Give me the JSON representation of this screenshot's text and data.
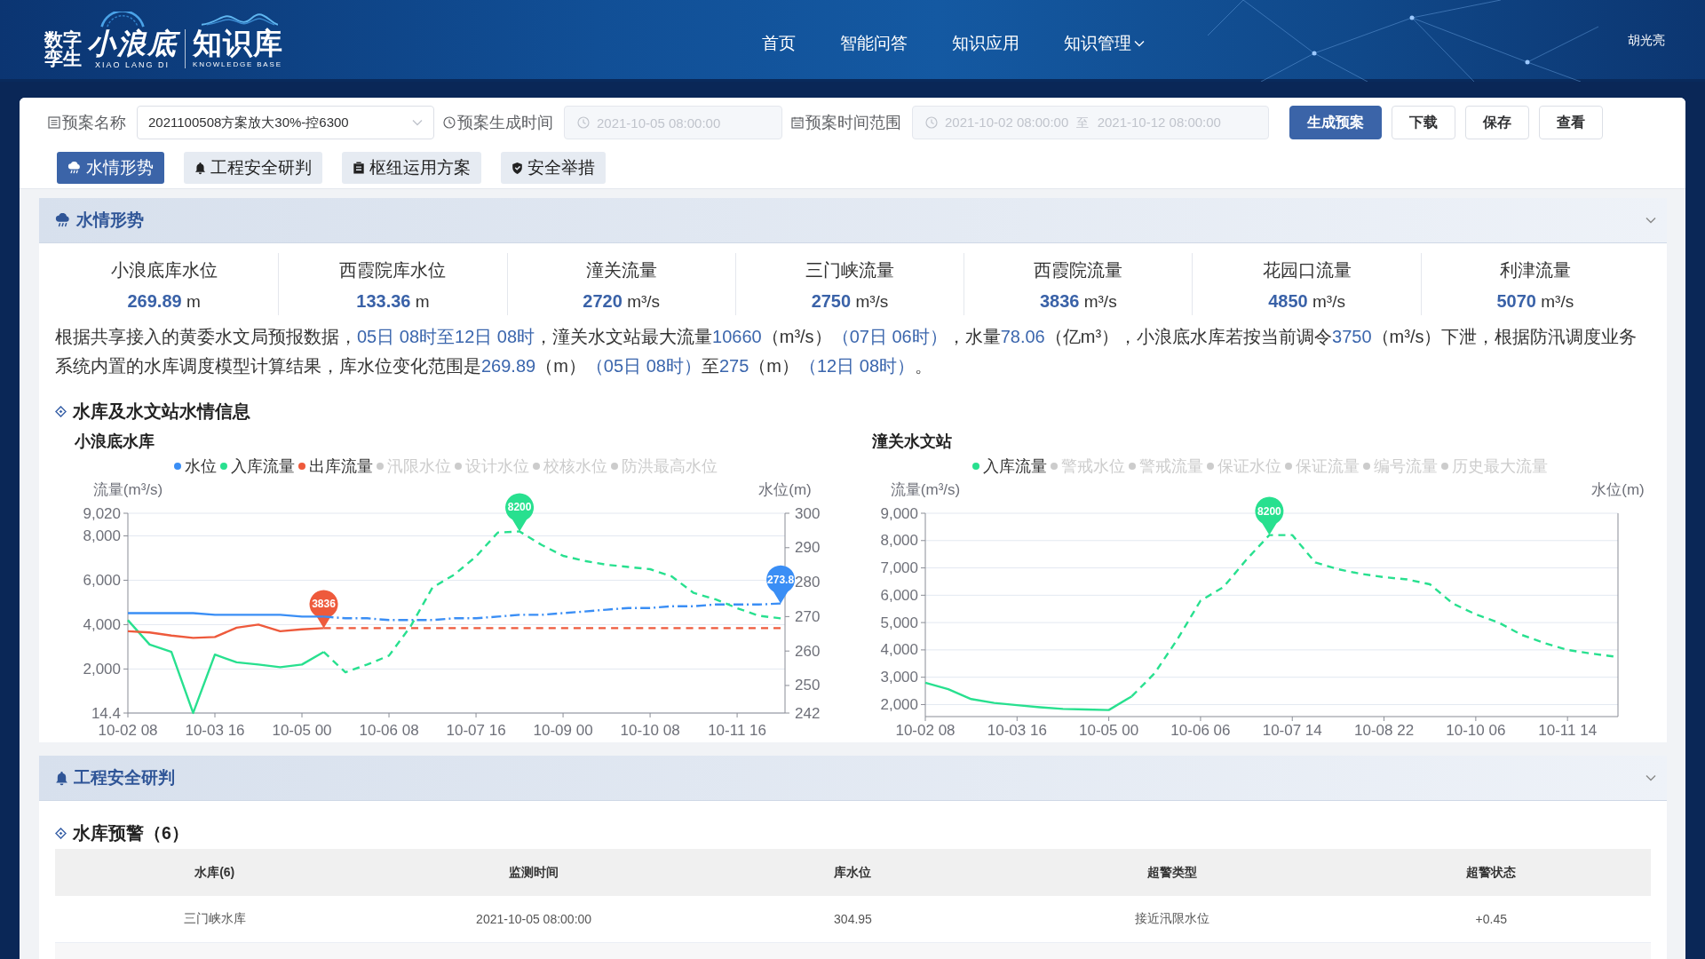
{
  "header": {
    "logo": {
      "prefix": "数字孪生",
      "name": "小浪底",
      "name_latin": "XIAO LANG DI",
      "title": "知识库",
      "title_latin": "KNOWLEDGE BASE"
    },
    "nav": [
      {
        "label": "首页",
        "dropdown": false
      },
      {
        "label": "智能问答",
        "dropdown": false
      },
      {
        "label": "知识应用",
        "dropdown": false
      },
      {
        "label": "知识管理",
        "dropdown": true
      }
    ],
    "user": "胡光亮"
  },
  "toolbar": {
    "fields": [
      {
        "kind": "select",
        "label": "预案名称",
        "value": "2021100508方案放大30%-控6300",
        "disabled": false
      },
      {
        "kind": "datetime",
        "label": "预案生成时间",
        "value": "2021-10-05 08:00:00",
        "disabled": true
      },
      {
        "kind": "range",
        "label": "预案时间范围",
        "start": "2021-10-02 08:00:00",
        "separator": "至",
        "end": "2021-10-12 08:00:00",
        "disabled": true
      }
    ],
    "buttons": [
      {
        "label": "生成预案",
        "primary": true
      },
      {
        "label": "下载",
        "primary": false
      },
      {
        "label": "保存",
        "primary": false
      },
      {
        "label": "查看",
        "primary": false
      }
    ]
  },
  "tabs": [
    {
      "label": "水情形势",
      "selected": true
    },
    {
      "label": "工程安全研判",
      "selected": false
    },
    {
      "label": "枢纽运用方案",
      "selected": false
    },
    {
      "label": "安全举措",
      "selected": false
    }
  ],
  "sections": [
    {
      "kind": "situation",
      "title": "水情形势",
      "expanded": true,
      "stats": [
        {
          "label": "小浪底库水位",
          "value": "269.89",
          "unit": "m"
        },
        {
          "label": "西霞院库水位",
          "value": "133.36",
          "unit": "m"
        },
        {
          "label": "潼关流量",
          "value": "2720",
          "unit": "m³/s"
        },
        {
          "label": "三门峡流量",
          "value": "2750",
          "unit": "m³/s"
        },
        {
          "label": "西霞院流量",
          "value": "3836",
          "unit": "m³/s"
        },
        {
          "label": "花园口流量",
          "value": "4850",
          "unit": "m³/s"
        },
        {
          "label": "利津流量",
          "value": "5070",
          "unit": "m³/s"
        }
      ],
      "summary": [
        {
          "text": "根据共享接入的黄委水文局预报数据，",
          "highlight": false
        },
        {
          "text": "05日 08时至12日 08时",
          "highlight": true
        },
        {
          "text": "，潼关水文站最大流量",
          "highlight": false
        },
        {
          "text": "10660",
          "highlight": true
        },
        {
          "text": "（m³/s）",
          "highlight": false
        },
        {
          "text": "（07日 06时）",
          "highlight": true
        },
        {
          "text": "，水量",
          "highlight": false
        },
        {
          "text": "78.06",
          "highlight": true
        },
        {
          "text": "（亿m³），小浪底水库若按当前调令",
          "highlight": false
        },
        {
          "text": "3750",
          "highlight": true
        },
        {
          "text": "（m³/s）下泄，根据防汛调度业务系统内置的水库调度模型计算结果，库水位变化范围是",
          "highlight": false
        },
        {
          "text": "269.89",
          "highlight": true
        },
        {
          "text": "（m）",
          "highlight": false
        },
        {
          "text": "（05日 08时）",
          "highlight": true
        },
        {
          "text": "至",
          "highlight": false
        },
        {
          "text": "275",
          "highlight": true
        },
        {
          "text": "（m）",
          "highlight": false
        },
        {
          "text": "（12日 08时）",
          "highlight": true
        },
        {
          "text": "。",
          "highlight": false
        }
      ],
      "charts_title": "水库及水文站水情信息",
      "charts": [
        {
          "title": "小浪底水库",
          "chart_data": {
            "type": "line",
            "legend": "top",
            "grid": true,
            "ylabel": "流量(m³/s)",
            "y2label": "水位(m)",
            "categories": [
              "10-02 08",
              null,
              null,
              null,
              "10-03 16",
              null,
              null,
              null,
              "10-05 00",
              null,
              null,
              null,
              "10-06 08",
              null,
              null,
              null,
              "10-07 16",
              null,
              null,
              null,
              "10-09 00",
              null,
              null,
              null,
              "10-10 08",
              null,
              null,
              null,
              "10-11 16",
              null,
              null
            ],
            "ylim": [
              14.4,
              9020
            ],
            "yticks": [
              {
                "value": 14.4,
                "label": "14.4"
              },
              {
                "value": 2000,
                "label": "2,000"
              },
              {
                "value": 4000,
                "label": "4,000"
              },
              {
                "value": 6000,
                "label": "6,000"
              },
              {
                "value": 8000,
                "label": "8,000"
              },
              {
                "value": 9020,
                "label": "9,020"
              }
            ],
            "y2lim": [
              242,
              300
            ],
            "y2ticks": [
              242,
              250,
              260,
              270,
              280,
              290,
              300
            ],
            "series": [
              {
                "name": "水位",
                "color": "#3a8ef5",
                "axis": "y2",
                "values": [
                  271,
                  271,
                  271,
                  271,
                  270.5,
                  270.5,
                  270.5,
                  270.5,
                  270,
                  270,
                  null,
                  null,
                  null,
                  null,
                  null,
                  null,
                  null,
                  null,
                  null,
                  null,
                  null,
                  null,
                  null,
                  null,
                  null,
                  null,
                  null,
                  null,
                  null,
                  null,
                  null
                ]
              },
              {
                "name": "入库流量",
                "color": "#28e08f",
                "values": [
                  4200,
                  3100,
                  2770,
                  20,
                  2650,
                  2300,
                  2200,
                  2080,
                  2200,
                  2770,
                  null,
                  null,
                  null,
                  null,
                  null,
                  null,
                  null,
                  null,
                  null,
                  null,
                  null,
                  null,
                  null,
                  null,
                  null,
                  null,
                  null,
                  null,
                  null,
                  null,
                  null
                ]
              },
              {
                "name": "出库流量",
                "color": "#ee5a3c",
                "values": [
                  3700,
                  3650,
                  3510,
                  3400,
                  3440,
                  3860,
                  4000,
                  3700,
                  3790,
                  3840,
                  null,
                  null,
                  null,
                  null,
                  null,
                  null,
                  null,
                  null,
                  null,
                  null,
                  null,
                  null,
                  null,
                  null,
                  null,
                  null,
                  null,
                  null,
                  null,
                  null,
                  null
                ]
              },
              {
                "name": "汛限水位",
                "values": [
                  null,
                  null,
                  null,
                  null,
                  null,
                  null,
                  null,
                  null,
                  null,
                  null,
                  null,
                  null,
                  null,
                  null,
                  null,
                  null,
                  null,
                  null,
                  null,
                  null,
                  null,
                  null,
                  null,
                  null,
                  null,
                  null,
                  null,
                  null,
                  null,
                  null,
                  null
                ]
              },
              {
                "name": "设计水位",
                "values": [
                  null,
                  null,
                  null,
                  null,
                  null,
                  null,
                  null,
                  null,
                  null,
                  null,
                  null,
                  null,
                  null,
                  null,
                  null,
                  null,
                  null,
                  null,
                  null,
                  null,
                  null,
                  null,
                  null,
                  null,
                  null,
                  null,
                  null,
                  null,
                  null,
                  null,
                  null
                ]
              },
              {
                "name": "校核水位",
                "values": [
                  null,
                  null,
                  null,
                  null,
                  null,
                  null,
                  null,
                  null,
                  null,
                  null,
                  null,
                  null,
                  null,
                  null,
                  null,
                  null,
                  null,
                  null,
                  null,
                  null,
                  null,
                  null,
                  null,
                  null,
                  null,
                  null,
                  null,
                  null,
                  null,
                  null,
                  null
                ]
              },
              {
                "name": "防洪最高水位",
                "values": [
                  null,
                  null,
                  null,
                  null,
                  null,
                  null,
                  null,
                  null,
                  null,
                  null,
                  null,
                  null,
                  null,
                  null,
                  null,
                  null,
                  null,
                  null,
                  null,
                  null,
                  null,
                  null,
                  null,
                  null,
                  null,
                  null,
                  null,
                  null,
                  null,
                  null,
                  null
                ]
              },
              {
                "color": "#3a8ef5",
                "axis": "y2",
                "line_style": "dashdot",
                "values": [
                  null,
                  null,
                  null,
                  null,
                  null,
                  null,
                  null,
                  null,
                  null,
                  270,
                  269.5,
                  269.5,
                  269,
                  269,
                  269,
                  269.5,
                  269.5,
                  270,
                  270.5,
                  270.5,
                  271,
                  271.5,
                  272,
                  272.5,
                  272.5,
                  273,
                  273,
                  273.5,
                  273.5,
                  273.5,
                  273.8
                ]
              },
              {
                "color": "#28e08f",
                "line_style": "dashed",
                "values": [
                  null,
                  null,
                  null,
                  null,
                  null,
                  null,
                  null,
                  null,
                  null,
                  2770,
                  1850,
                  2200,
                  2600,
                  3930,
                  5670,
                  6250,
                  7070,
                  8150,
                  8200,
                  7600,
                  7100,
                  6870,
                  6700,
                  6600,
                  6500,
                  6170,
                  5430,
                  5140,
                  4740,
                  4400,
                  4280
                ]
              },
              {
                "color": "#ee5a3c",
                "line_style": "dashed",
                "values": [
                  null,
                  null,
                  null,
                  null,
                  null,
                  null,
                  null,
                  null,
                  null,
                  3840,
                  3840,
                  3840,
                  3840,
                  3840,
                  3840,
                  3840,
                  3840,
                  3840,
                  3840,
                  3840,
                  3840,
                  3840,
                  3840,
                  3840,
                  3840,
                  3840,
                  3840,
                  3840,
                  3840,
                  3840,
                  3840
                ]
              }
            ],
            "annotations": [
              {
                "y": 3840,
                "text": "3836"
              },
              {
                "y": 8200,
                "text": "8200"
              },
              "273.8"
            ]
          }
        },
        {
          "title": "潼关水文站",
          "chart_data": {
            "type": "line",
            "legend": "top",
            "grid": true,
            "ylabel": "流量(m³/s)",
            "y2label": "水位(m)",
            "categories": [
              "10-02 08",
              null,
              null,
              null,
              "10-03 16",
              null,
              null,
              null,
              "10-05 00",
              null,
              null,
              null,
              "10-06 06",
              null,
              null,
              null,
              "10-07 14",
              null,
              null,
              null,
              "10-08 22",
              null,
              null,
              null,
              "10-10 06",
              null,
              null,
              null,
              "10-11 14",
              null,
              null
            ],
            "ylim": [
              1560,
              9000
            ],
            "yticks": [
              {
                "value": 2000,
                "label": "2,000"
              },
              {
                "value": 3000,
                "label": "3,000"
              },
              {
                "value": 4000,
                "label": "4,000"
              },
              {
                "value": 5000,
                "label": "5,000"
              },
              {
                "value": 6000,
                "label": "6,000"
              },
              {
                "value": 7000,
                "label": "7,000"
              },
              {
                "value": 8000,
                "label": "8,000"
              },
              {
                "value": 9000,
                "label": "9,000"
              }
            ],
            "series": [
              {
                "name": "入库流量",
                "color": "#28e08f",
                "values": [
                  2800,
                  2560,
                  2200,
                  2060,
                  1980,
                  1900,
                  1840,
                  1820,
                  1800,
                  2300,
                  null,
                  null,
                  null,
                  null,
                  null,
                  null,
                  null,
                  null,
                  null,
                  null,
                  null,
                  null,
                  null,
                  null,
                  null,
                  null,
                  null,
                  null,
                  null,
                  null,
                  null
                ]
              },
              {
                "name": "警戒水位",
                "values": [
                  null,
                  null,
                  null,
                  null,
                  null,
                  null,
                  null,
                  null,
                  null,
                  null,
                  null,
                  null,
                  null,
                  null,
                  null,
                  null,
                  null,
                  null,
                  null,
                  null,
                  null,
                  null,
                  null,
                  null,
                  null,
                  null,
                  null,
                  null,
                  null,
                  null,
                  null
                ]
              },
              {
                "name": "警戒流量",
                "values": [
                  null,
                  null,
                  null,
                  null,
                  null,
                  null,
                  null,
                  null,
                  null,
                  null,
                  null,
                  null,
                  null,
                  null,
                  null,
                  null,
                  null,
                  null,
                  null,
                  null,
                  null,
                  null,
                  null,
                  null,
                  null,
                  null,
                  null,
                  null,
                  null,
                  null,
                  null
                ]
              },
              {
                "name": "保证水位",
                "values": [
                  null,
                  null,
                  null,
                  null,
                  null,
                  null,
                  null,
                  null,
                  null,
                  null,
                  null,
                  null,
                  null,
                  null,
                  null,
                  null,
                  null,
                  null,
                  null,
                  null,
                  null,
                  null,
                  null,
                  null,
                  null,
                  null,
                  null,
                  null,
                  null,
                  null,
                  null
                ]
              },
              {
                "name": "保证流量",
                "values": [
                  null,
                  null,
                  null,
                  null,
                  null,
                  null,
                  null,
                  null,
                  null,
                  null,
                  null,
                  null,
                  null,
                  null,
                  null,
                  null,
                  null,
                  null,
                  null,
                  null,
                  null,
                  null,
                  null,
                  null,
                  null,
                  null,
                  null,
                  null,
                  null,
                  null,
                  null
                ]
              },
              {
                "name": "编号流量",
                "values": [
                  null,
                  null,
                  null,
                  null,
                  null,
                  null,
                  null,
                  null,
                  null,
                  null,
                  null,
                  null,
                  null,
                  null,
                  null,
                  null,
                  null,
                  null,
                  null,
                  null,
                  null,
                  null,
                  null,
                  null,
                  null,
                  null,
                  null,
                  null,
                  null,
                  null,
                  null
                ]
              },
              {
                "name": "历史最大流量",
                "values": [
                  null,
                  null,
                  null,
                  null,
                  null,
                  null,
                  null,
                  null,
                  null,
                  null,
                  null,
                  null,
                  null,
                  null,
                  null,
                  null,
                  null,
                  null,
                  null,
                  null,
                  null,
                  null,
                  null,
                  null,
                  null,
                  null,
                  null,
                  null,
                  null,
                  null,
                  null
                ]
              },
              {
                "color": "#28e08f",
                "line_style": "dashed",
                "values": [
                  null,
                  null,
                  null,
                  null,
                  null,
                  null,
                  null,
                  null,
                  null,
                  2300,
                  3150,
                  4400,
                  5800,
                  6300,
                  7300,
                  8200,
                  8200,
                  7200,
                  6950,
                  6780,
                  6660,
                  6580,
                  6400,
                  5700,
                  5300,
                  5000,
                  4550,
                  4250,
                  4000,
                  3870,
                  3760
                ]
              }
            ],
            "annotations": [
              {
                "y": 8200,
                "text": "8200"
              }
            ]
          }
        }
      ]
    },
    {
      "kind": "safety",
      "title": "工程安全研判",
      "expanded": true,
      "table_title": "水库预警（6）",
      "table": {
        "columns": [
          "水库(6)",
          "监测时间",
          "库水位",
          "超警类型",
          "超警状态"
        ],
        "rows": [
          [
            "三门峡水库",
            "2021-10-05 08:00:00",
            "304.95",
            "接近汛限水位",
            "+0.45"
          ]
        ]
      }
    }
  ]
}
